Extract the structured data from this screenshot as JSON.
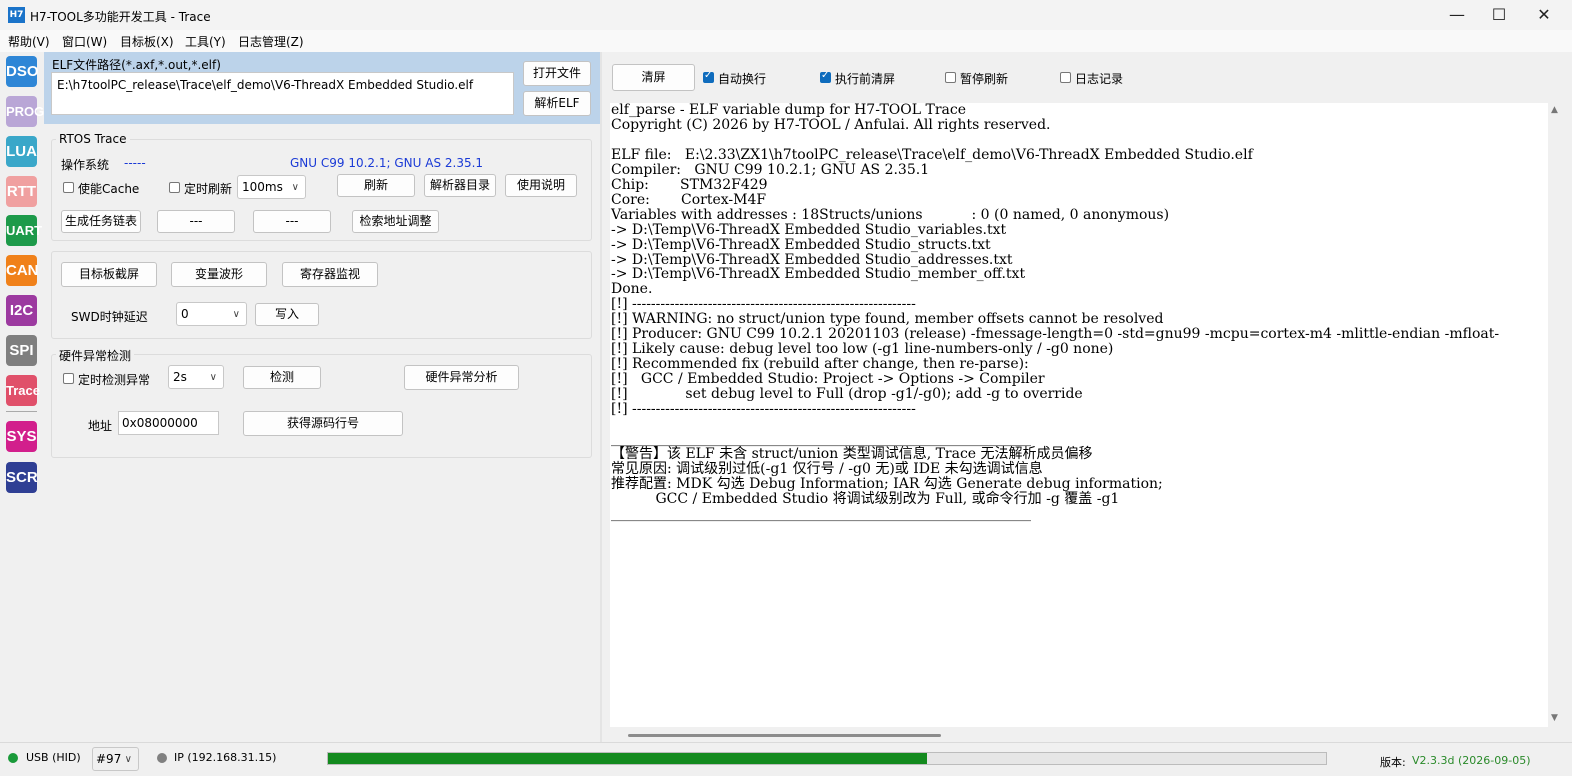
{
  "window": {
    "logo": "H7",
    "title": "H7-TOOL多功能开发工具 - Trace",
    "minimize": "—",
    "maximize": "☐",
    "close": "✕"
  },
  "menu": [
    "帮助(V)",
    "窗口(W)",
    "目标板(X)",
    "工具(Y)",
    "日志管理(Z)"
  ],
  "sidebar": [
    {
      "label": "DSO",
      "color": "#2e86d6"
    },
    {
      "label": "PROG",
      "color": "#b9a6d6"
    },
    {
      "label": "LUA",
      "color": "#3aa7c9"
    },
    {
      "label": "RTT",
      "color": "#f0a0a0"
    },
    {
      "label": "UART",
      "color": "#1d9a4a"
    },
    {
      "label": "CAN",
      "color": "#f0811a"
    },
    {
      "label": "I2C",
      "color": "#9c3aa0"
    },
    {
      "label": "SPI",
      "color": "#7f7f7f"
    },
    {
      "label": "Trace",
      "color": "#e0506a"
    },
    {
      "label": "SYS",
      "color": "#d21f8c"
    },
    {
      "label": "SCR",
      "color": "#2f3f94"
    }
  ],
  "elf": {
    "label": "ELF文件路径(*.axf,*.out,*.elf)",
    "path": "E:\\h7toolPC_release\\Trace\\elf_demo\\V6-ThreadX Embedded Studio.elf",
    "open_button": "打开文件",
    "parse_button": "解析ELF"
  },
  "rtos": {
    "group_title": "RTOS Trace",
    "os_label": "操作系统",
    "os_value": "-----",
    "compiler": "GNU C99 10.2.1; GNU AS 2.35.1",
    "cache_label": "使能Cache",
    "timer_refresh_label": "定时刷新",
    "interval": "100ms",
    "refresh_button": "刷新",
    "parser_dir_button": "解析器目录",
    "help_button": "使用说明",
    "task_chain_button": "生成任务链表",
    "blank1": "---",
    "blank2": "---",
    "addr_adjust_button": "检索地址调整"
  },
  "tools": {
    "screenshot_button": "目标板截屏",
    "wave_button": "变量波形",
    "reg_monitor_button": "寄存器监视",
    "swd_delay_label": "SWD时钟延迟",
    "swd_delay_value": "0",
    "write_button": "写入"
  },
  "hw": {
    "group_title": "硬件异常检测",
    "timer_detect_label": "定时检测异常",
    "interval": "2s",
    "detect_button": "检测",
    "analyze_button": "硬件异常分析",
    "addr_label": "地址",
    "addr_value": "0x08000000",
    "get_line_button": "获得源码行号"
  },
  "log_toolbar": {
    "clear_button": "清屏",
    "auto_wrap": {
      "label": "自动换行",
      "checked": true
    },
    "clear_before": {
      "label": "执行前清屏",
      "checked": true
    },
    "pause_refresh": {
      "label": "暂停刷新",
      "checked": false
    },
    "log_record": {
      "label": "日志记录",
      "checked": false
    }
  },
  "log_lines": [
    "elf_parse - ELF variable dump for H7-TOOL Trace",
    "Copyright (C) 2026 by H7-TOOL / Anfulai. All rights reserved.",
    "",
    "ELF file:   E:\\2.33\\ZX1\\h7toolPC_release\\Trace\\elf_demo\\V6-ThreadX Embedded Studio.elf",
    "Compiler:   GNU C99 10.2.1; GNU AS 2.35.1",
    "Chip:       STM32F429",
    "Core:       Cortex-M4F",
    "Variables with addresses : 18Structs/unions           : 0 (0 named, 0 anonymous)",
    "-> D:\\Temp\\V6-ThreadX Embedded Studio_variables.txt",
    "-> D:\\Temp\\V6-ThreadX Embedded Studio_structs.txt",
    "-> D:\\Temp\\V6-ThreadX Embedded Studio_addresses.txt",
    "-> D:\\Temp\\V6-ThreadX Embedded Studio_member_off.txt",
    "Done.",
    "[!] ------------------------------------------------------------",
    "[!] WARNING: no struct/union type found, member offsets cannot be resolved",
    "[!] Producer: GNU C99 10.2.1 20201103 (release) -fmessage-length=0 -std=gnu99 -mcpu=cortex-m4 -mlittle-endian -mfloat-",
    "[!] Likely cause: debug level too low (-g1 line-numbers-only / -g0 none)",
    "[!] Recommended fix (rebuild after change, then re-parse):",
    "[!]   GCC / Embedded Studio: Project -> Options -> Compiler",
    "[!]             set debug level to Full (drop -g1/-g0); add -g to override",
    "[!] ------------------------------------------------------------",
    "",
    "____________________________________________________________",
    "【警告】该 ELF 未含 struct/union 类型调试信息, Trace 无法解析成员偏移",
    "常见原因: 调试级别过低(-g1 仅行号 / -g0 无)或 IDE 未勾选调试信息",
    "推荐配置: MDK 勾选 Debug Information; IAR 勾选 Generate debug information;",
    "          GCC / Embedded Studio 将调试级别改为 Full, 或命令行加 -g 覆盖 -g1",
    "____________________________________________________________"
  ],
  "status": {
    "usb": "USB (HID)",
    "usb_color": "#1a9a3a",
    "device": "#97",
    "ip": "IP (192.168.31.15)",
    "ip_color": "#808080",
    "progress": 0.6,
    "progress_color": "#138a1e",
    "version_label": "版本:",
    "version": "V2.3.3d (2026-09-05)",
    "version_color": "#2a8a2a"
  }
}
